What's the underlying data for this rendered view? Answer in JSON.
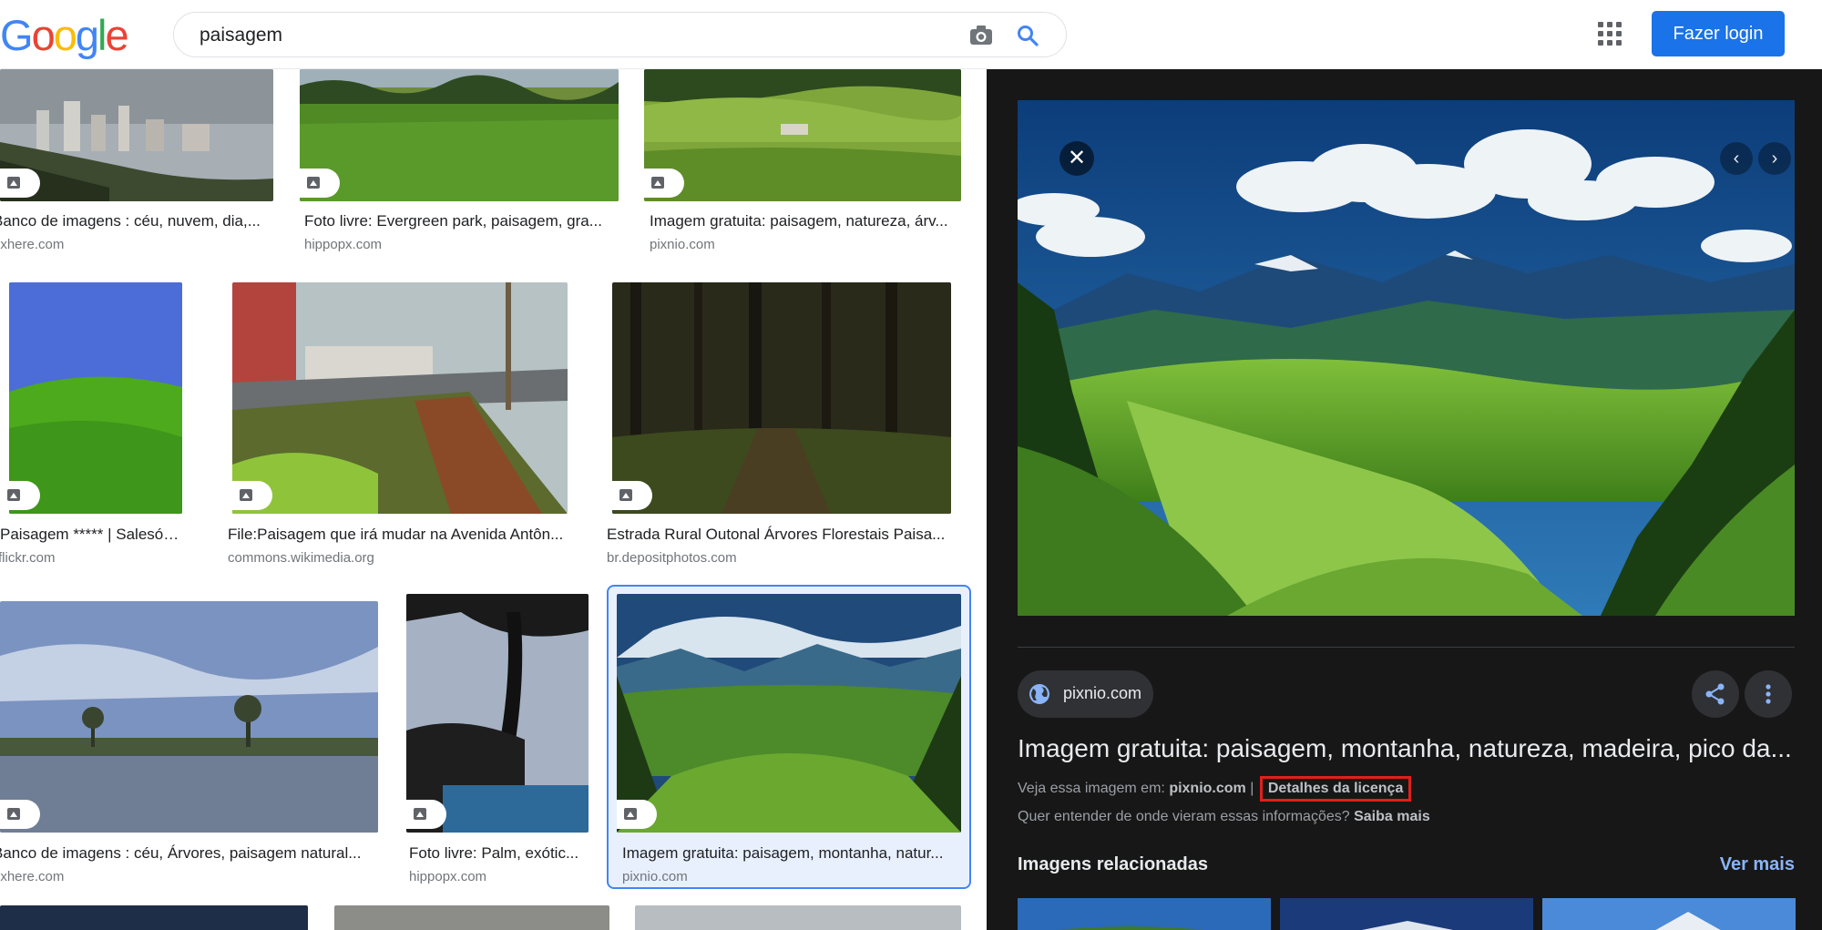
{
  "header": {
    "logo_letters": [
      "G",
      "o",
      "o",
      "g",
      "l",
      "e"
    ],
    "logo_colors": [
      "#4285f4",
      "#ea4335",
      "#fbbc05",
      "#4285f4",
      "#34a853",
      "#ea4335"
    ],
    "search_query": "paisagem",
    "login_label": "Fazer login",
    "icons": [
      "camera-icon",
      "search-icon",
      "apps-grid-icon"
    ]
  },
  "results": [
    {
      "title": "Banco de imagens : céu, nuvem, dia,...",
      "source": "pxhere.com"
    },
    {
      "title": "Foto livre: Evergreen park, paisagem, gra...",
      "source": "hippopx.com"
    },
    {
      "title": "Imagem gratuita: paisagem, natureza, árv...",
      "source": "pixnio.com"
    },
    {
      "title": "Paisagem ***** | Salesóp...",
      "source": "flickr.com"
    },
    {
      "title": "File:Paisagem que irá mudar na Avenida Antôn...",
      "source": "commons.wikimedia.org"
    },
    {
      "title": "Estrada Rural Outonal Árvores Florestais Paisa...",
      "source": "br.depositphotos.com"
    },
    {
      "title": "Banco de imagens : céu, Árvores, paisagem natural...",
      "source": "pxhere.com"
    },
    {
      "title": "Foto livre: Palm, exótic...",
      "source": "hippopx.com"
    },
    {
      "title": "Imagem gratuita: paisagem, montanha, natur...",
      "source": "pixnio.com"
    }
  ],
  "panel": {
    "site": "pixnio.com",
    "title": "Imagem gratuita: paisagem, montanha, natureza, madeira, pico da...",
    "view_prefix": "Veja essa imagem em:",
    "view_site": "pixnio.com",
    "separator": "|",
    "license_label": "Detalhes da licença",
    "question": "Quer entender de onde vieram essas informações?",
    "learn_more": "Saiba mais",
    "related_heading": "Imagens relacionadas",
    "see_more": "Ver mais",
    "close_glyph": "✕",
    "prev_glyph": "‹",
    "next_glyph": "›"
  },
  "colors": {
    "accent": "#1a73e8",
    "panel_bg": "#171717",
    "link": "#8ab4f8",
    "highlight_border": "#e0201c"
  }
}
